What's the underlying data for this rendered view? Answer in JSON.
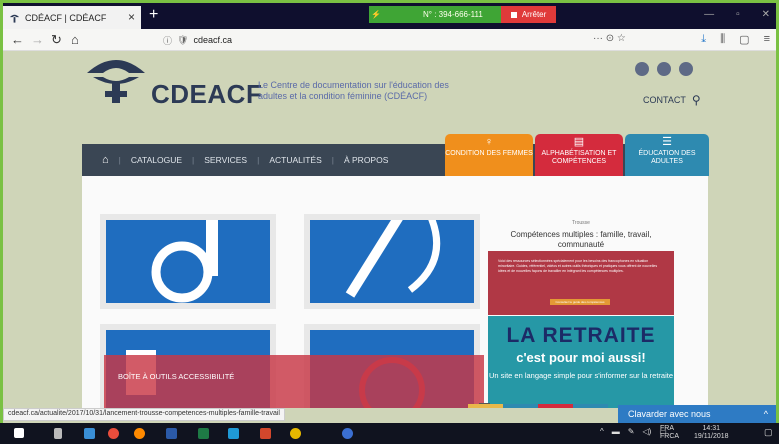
{
  "browser": {
    "tab_title": "CDÉACF | CDÉACF",
    "tab_close": "×",
    "new_tab": "+",
    "url": "cdeacf.ca",
    "url_actions": "··· ⊙ ☆",
    "share_number": "N° : 394-666-111",
    "share_stop": "Arrêter",
    "status_url": "cdeacf.ca/actualite/2017/10/31/lancement-trousse-competences-multiples-famille-travail"
  },
  "site": {
    "brand": "CDEACF",
    "tagline": "Le Centre de documentation sur l'éducation des adultes et la condition féminine (CDÉACF)",
    "contact": "CONTACT",
    "nav": {
      "catalogue": "CATALOGUE",
      "services": "SERVICES",
      "actualites": "ACTUALITÉS",
      "apropos": "À PROPOS",
      "sep": "|"
    },
    "categories": [
      {
        "label": "CONDITION DES FEMMES",
        "icon": "female-icon"
      },
      {
        "label": "ALPHABÉTISATION ET COMPÉTENCES",
        "icon": "book-icon"
      },
      {
        "label": "ÉDUCATION DES ADULTES",
        "icon": "menu-icon"
      }
    ]
  },
  "content": {
    "overlay_label": "BOÎTE À OUTILS ACCESSIBILITÉ",
    "promo_small": "Trousse",
    "promo_title": "Compétences multiples : famille, travail, communauté",
    "promo_red_text": "Voici des ressources sélectionnées spécialement pour les besoins des francophones en situation minoritaire. Guides, référentiel, vidéos et autres outils théoriques et pratiques vous offrent de nouvelles idées et de nouvelles façons de travailler en intégrant les compétences multiples.",
    "promo_red_button": "Consultez le guide des compétences",
    "promo_teal_title": "LA RETRAITE",
    "promo_teal_sub": "c'est pour moi aussi!",
    "promo_teal_text": "Un site en langage simple pour s'informer sur la retraite",
    "plus": "+"
  },
  "chat": {
    "label": "Clavarder avec nous",
    "caret": "^"
  },
  "taskbar": {
    "lang1": "FRA",
    "lang2": "FRCA",
    "time": "14:31",
    "date": "19/11/2018"
  },
  "colors": {
    "frame_green": "#7ac143",
    "nav_dark": "#3a4654",
    "orange": "#f08f1c",
    "red": "#d42b3d",
    "blue": "#2e8ab0",
    "tile_blue": "#1f6dbf",
    "teal": "#2698a6"
  }
}
